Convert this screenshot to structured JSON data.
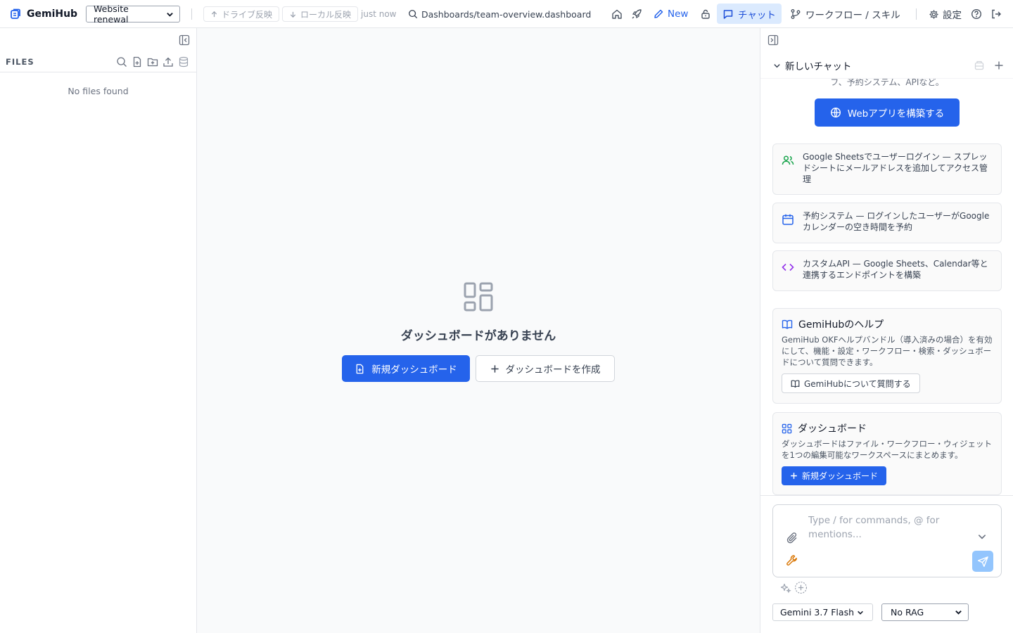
{
  "header": {
    "brand": "GemiHub",
    "project": "Website renewal",
    "drive_sync_label": "ドライブ反映",
    "local_sync_label": "ローカル反映",
    "sync_status": "just now",
    "file_path": "Dashboards/team-overview.dashboard",
    "new_label": "New",
    "chat_tab_label": "チャット",
    "workflow_label": "ワークフロー / スキル",
    "settings_label": "設定",
    "accent_color": "#2563eb"
  },
  "sidebar": {
    "section_label": "FILES",
    "empty_text": "No files found"
  },
  "main": {
    "empty_title": "ダッシュボードがありません",
    "new_dashboard_label": "新規ダッシュボード",
    "create_dashboard_label": "ダッシュボードを作成"
  },
  "chat": {
    "title": "新しいチャット",
    "cut_text": "フ、予約システム、APIなど。",
    "build_webapp_label": "Webアプリを構築する",
    "suggestions": [
      {
        "icon": "users-icon",
        "text": "Google Sheetsでユーザーログイン — スプレッドシートにメールアドレスを追加してアクセス管理"
      },
      {
        "icon": "calendar-icon",
        "text": "予約システム — ログインしたユーザーがGoogleカレンダーの空き時間を予約"
      },
      {
        "icon": "code-icon",
        "text": "カスタムAPI — Google Sheets、Calendar等と連携するエンドポイントを構築"
      }
    ],
    "help_card": {
      "title": "GemiHubのヘルプ",
      "desc": "GemiHub OKFヘルプバンドル（導入済みの場合）を有効にして、機能・設定・ワークフロー・検索・ダッシュボードについて質問できます。",
      "button_label": "GemiHubについて質問する"
    },
    "dashboard_card": {
      "title": "ダッシュボード",
      "desc": "ダッシュボードはファイル・ワークフロー・ウィジェットを1つの編集可能なワークスペースにまとめます。",
      "button_label": "新規ダッシュボード"
    },
    "composer_placeholder": "Type / for commands, @ for mentions...",
    "model": "Gemini 3.7 Flash",
    "rag": "No RAG"
  }
}
